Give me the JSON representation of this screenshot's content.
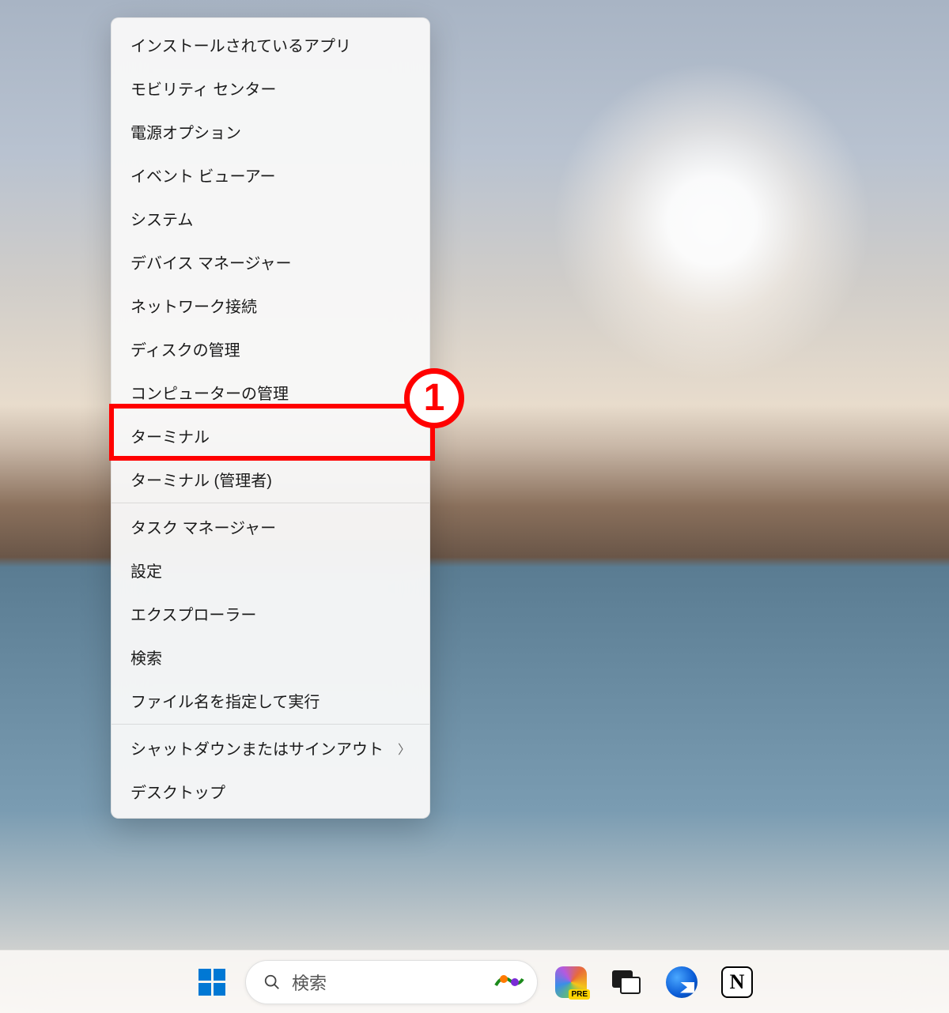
{
  "menu": {
    "groups": [
      [
        {
          "label": "インストールされているアプリ",
          "id": "installed-apps"
        },
        {
          "label": "モビリティ センター",
          "id": "mobility-center"
        },
        {
          "label": "電源オプション",
          "id": "power-options"
        },
        {
          "label": "イベント ビューアー",
          "id": "event-viewer"
        },
        {
          "label": "システム",
          "id": "system"
        },
        {
          "label": "デバイス マネージャー",
          "id": "device-manager"
        },
        {
          "label": "ネットワーク接続",
          "id": "network-connections"
        },
        {
          "label": "ディスクの管理",
          "id": "disk-management"
        },
        {
          "label": "コンピューターの管理",
          "id": "computer-management"
        },
        {
          "label": "ターミナル",
          "id": "terminal"
        },
        {
          "label": "ターミナル (管理者)",
          "id": "terminal-admin"
        }
      ],
      [
        {
          "label": "タスク マネージャー",
          "id": "task-manager"
        },
        {
          "label": "設定",
          "id": "settings"
        },
        {
          "label": "エクスプローラー",
          "id": "explorer"
        },
        {
          "label": "検索",
          "id": "search"
        },
        {
          "label": "ファイル名を指定して実行",
          "id": "run"
        }
      ],
      [
        {
          "label": "シャットダウンまたはサインアウト",
          "id": "shutdown-signout",
          "submenu": true
        },
        {
          "label": "デスクトップ",
          "id": "show-desktop"
        }
      ]
    ]
  },
  "annotation": {
    "badge": "1"
  },
  "taskbar": {
    "search_placeholder": "検索",
    "notion_glyph": "N",
    "copilot_badge": "PRE"
  }
}
